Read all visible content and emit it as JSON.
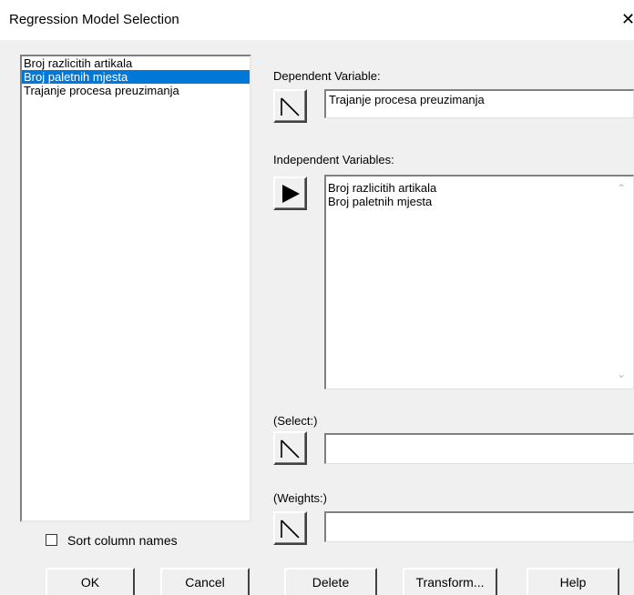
{
  "window": {
    "title": "Regression Model Selection",
    "close_glyph": "✕"
  },
  "columns": {
    "items": [
      {
        "label": "Broj razlicitih artikala",
        "selected": false
      },
      {
        "label": "Broj paletnih mjesta",
        "selected": true
      },
      {
        "label": "Trajanje procesa preuzimanja",
        "selected": false
      }
    ]
  },
  "dependent": {
    "label": "Dependent Variable:",
    "value": "Trajanje procesa preuzimanja"
  },
  "independent": {
    "label": "Independent Variables:",
    "values": [
      "Broj razlicitih artikala",
      "Broj paletnih mjesta"
    ]
  },
  "select": {
    "label": "(Select:)",
    "value": ""
  },
  "weights": {
    "label": "(Weights:)",
    "value": ""
  },
  "sort": {
    "label": "Sort column names",
    "checked": false
  },
  "buttons": {
    "ok": "OK",
    "cancel": "Cancel",
    "delete": "Delete",
    "transform": "Transform...",
    "help": "Help"
  },
  "colors": {
    "selection": "#0078d7",
    "face": "#f0f0f0"
  },
  "icons": {
    "dependent_arrow": "outline-arrow-icon",
    "independent_arrow": "filled-arrow-icon",
    "select_arrow": "outline-arrow-icon",
    "weights_arrow": "outline-arrow-icon"
  }
}
